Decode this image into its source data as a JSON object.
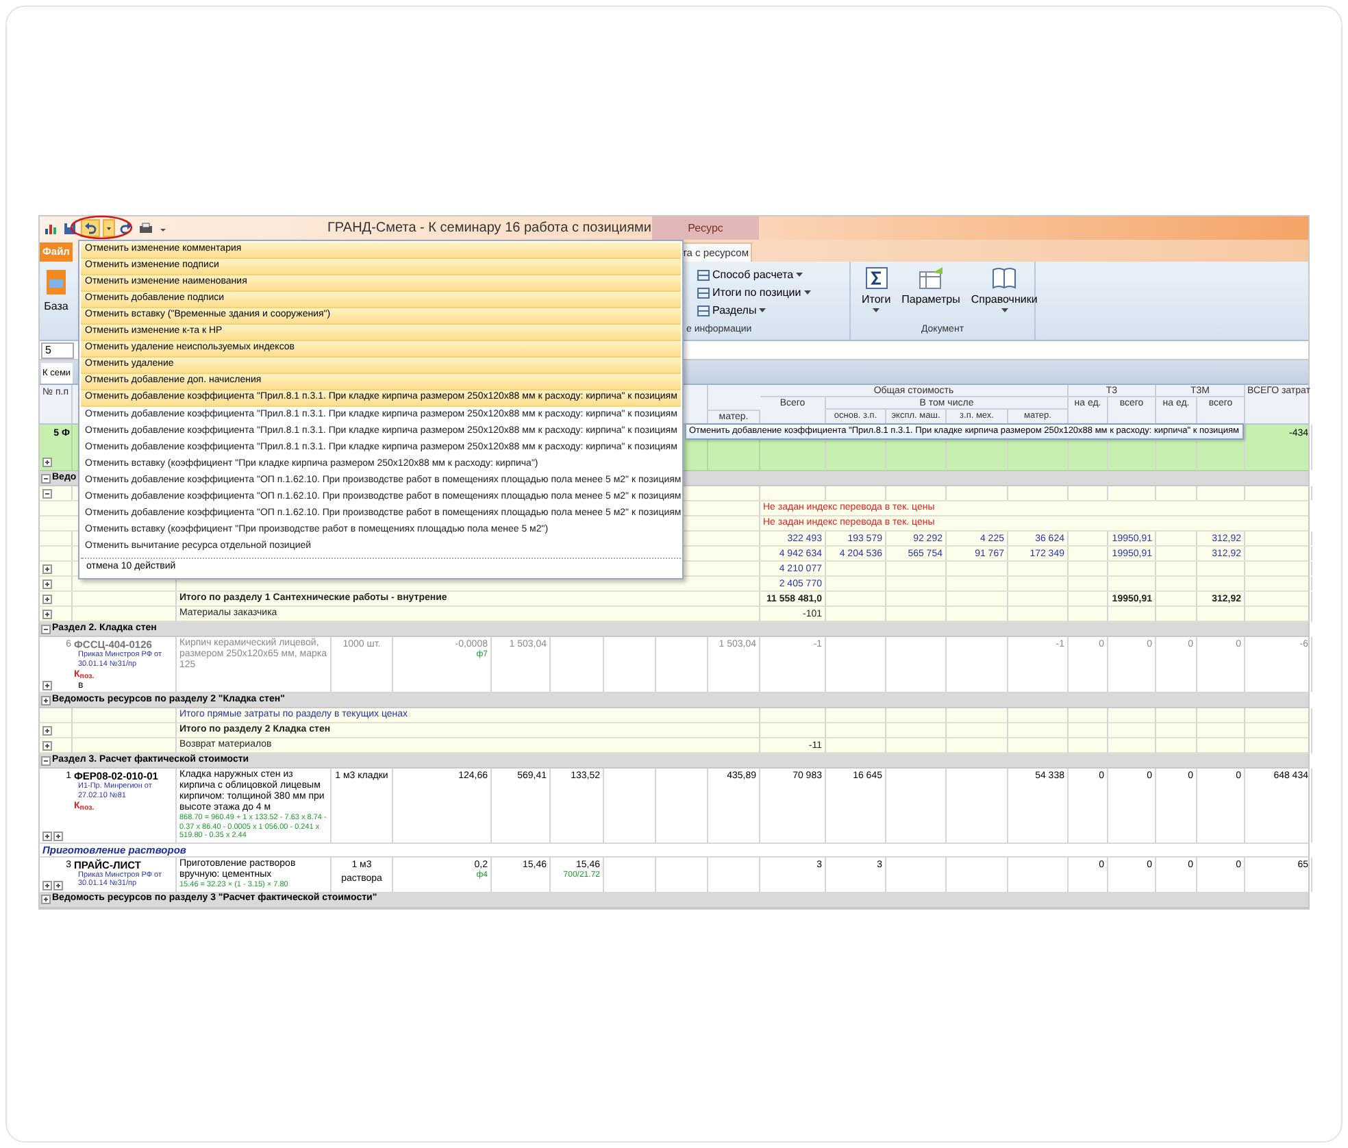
{
  "window": {
    "title": "ГРАНД-Смета - К семинару 16 работа с позициями",
    "context_tab": "Ресурс"
  },
  "quick_access": [
    {
      "kind": "app",
      "pressed": false
    },
    {
      "kind": "save",
      "pressed": false
    },
    {
      "kind": "undo",
      "pressed": true
    },
    {
      "kind": "caret",
      "pressed": true
    },
    {
      "kind": "redo",
      "pressed": false
    },
    {
      "kind": "print",
      "pressed": false
    },
    {
      "kind": "customize",
      "pressed": false
    }
  ],
  "tabs": [
    {
      "label": "Файл",
      "selected": true
    },
    {
      "label": "та с ресурсом",
      "selected": false
    }
  ],
  "ribbon": {
    "base_button": "База",
    "small_buttons": [
      {
        "label": "Способ расчета",
        "dropdown": true
      },
      {
        "label": "Итоги по позиции",
        "dropdown": true
      },
      {
        "label": "Разделы",
        "dropdown": true
      }
    ],
    "group_label": "е информации",
    "large_buttons": [
      {
        "kind": "sum",
        "label": "Итоги",
        "dropdown": true
      },
      {
        "kind": "params",
        "label": "Параметры",
        "dropdown": false
      },
      {
        "kind": "book",
        "label": "Справочники",
        "dropdown": true
      }
    ],
    "doc_group": "Документ"
  },
  "page_field": {
    "value": "5"
  },
  "doc_tab": {
    "label": "К семи"
  },
  "header": {
    "number": "№ п.п",
    "left_cols": [
      "матер."
    ],
    "total_group": "Общая стоимость",
    "total": "Всего",
    "incl": "В том числе",
    "incl_cols": [
      "основ. з.п.",
      "экспл. маш.",
      "з.п. мех.",
      "матер."
    ],
    "tz": "Т3",
    "tz_cols": [
      "на ед.",
      "всего"
    ],
    "tzm": "Т3М",
    "tzm_cols": [
      "на ед.",
      "всего"
    ],
    "grand": "ВСЕГО затрат"
  },
  "rows": [
    {
      "kind": "current",
      "number": "5",
      "code": "Ф",
      "expanded": false,
      "cells": {
        "grand_total": "-434"
      }
    },
    {
      "kind": "section",
      "title": "Ведо",
      "expanded": true
    },
    {
      "kind": "subtotal",
      "accent": false,
      "expanded": true,
      "cells": {}
    },
    {
      "kind": "note",
      "note": "Не задан индекс перевода в тек. цены"
    },
    {
      "kind": "note",
      "note": "Не задан индекс перевода в тек. цены"
    },
    {
      "kind": "subtotal",
      "accent": true,
      "cells": {
        "total": "322 493",
        "base_wage": "193 579",
        "machines": "92 292",
        "mech_wage": "4 225",
        "materials": "36 624",
        "tz_total": "19950,91",
        "tzm_total": "312,92"
      }
    },
    {
      "kind": "subtotal",
      "accent": true,
      "cells": {
        "total": "4 942 634",
        "base_wage": "4 204 536",
        "machines": "565 754",
        "mech_wage": "91 767",
        "materials": "172 349",
        "tz_total": "19950,91",
        "tzm_total": "312,92"
      }
    },
    {
      "kind": "subtotal",
      "accent": true,
      "expanded": false,
      "cells": {
        "total": "4 210 077"
      }
    },
    {
      "kind": "subtotal",
      "accent": true,
      "expanded": false,
      "cells": {
        "total": "2 405 770"
      }
    },
    {
      "kind": "total",
      "accent": false,
      "expanded": false,
      "label": "Итого по разделу 1 Сантехнические работы - внутрение",
      "cells": {
        "total": "11 558 481,0",
        "tz_total": "19950,91",
        "tzm_total": "312,92"
      }
    },
    {
      "kind": "subtotal",
      "accent": false,
      "expanded": false,
      "label": "Материалы заказчика",
      "cells": {
        "total": "-101"
      }
    },
    {
      "kind": "section",
      "title": "Раздел 2. Кладка стен",
      "expanded": true
    },
    {
      "kind": "position",
      "muted": true,
      "number": "6",
      "code": "ФССЦ-404-0126",
      "source": "Приказ Минстроя РФ от 30.01.14 №31/пр",
      "coef": "К$_{поз.}$",
      "extra": "в",
      "toggles": [
        {
          "expanded": false
        }
      ],
      "name": "Кирпич керамический лицевой, размером 250x120x65 мм, марка 125",
      "unit": "1000 шт.",
      "qty": {
        "text": "-0,0008",
        "note": "ф7"
      },
      "cells": {
        "column_6": "1 503,04",
        "column_10": "1 503,04",
        "total": "-1",
        "materials": "-1",
        "tz_unit": "0",
        "tz_total": "0",
        "tzm_unit": "0",
        "tzm_total": "0",
        "grand_total": "-6"
      }
    },
    {
      "kind": "section",
      "title": "Ведомость ресурсов по разделу 2 \"Кладка стен\"",
      "expanded": false
    },
    {
      "kind": "subtotal",
      "accent": true,
      "label": "Итого прямые затраты по разделу в текущих ценах",
      "cells": {}
    },
    {
      "kind": "total",
      "accent": false,
      "expanded": false,
      "label": "Итого по разделу 2 Кладка стен",
      "cells": {}
    },
    {
      "kind": "subtotal",
      "accent": false,
      "expanded": false,
      "label": "Возврат материалов",
      "cells": {
        "total": "-11"
      }
    },
    {
      "kind": "section",
      "title": "Раздел 3. Расчет фактической стоимости",
      "expanded": true
    },
    {
      "kind": "position",
      "muted": false,
      "number": "1",
      "code": "ФЕР08-02-010-01",
      "source": "И1-Пр. Минрегион от 27.02.10 №81",
      "coef": "К$_{поз.}$",
      "toggles": [
        {
          "expanded": false
        },
        {
          "expanded": false
        }
      ],
      "name": "Кладка наружных стен из кирпича с облицовкой лицевым кирпичом: толщиной 380 мм при высоте этажа до 4 м",
      "formula": "868.70 = 960.49 + 1 x 133.52 - 7.63 x 8.74 - 0.37 x 86.40 - 0.0005 x 1 056.00 - 0.241 x 519.80 - 0.35 x 2.44",
      "unit": "1 м3 кладки",
      "qty": {
        "text": "124,66"
      },
      "cells": {
        "column_6": "569,41",
        "column_7": "133,52",
        "column_10": "435,89",
        "total": "70 983",
        "base_wage": "16 645",
        "materials": "54 338",
        "tz_unit": "0",
        "tz_total": "0",
        "tzm_unit": "0",
        "tzm_total": "0",
        "grand_total": "648 434"
      }
    },
    {
      "kind": "category",
      "title": "Приготовление растворов"
    },
    {
      "kind": "position",
      "muted": false,
      "number": "3",
      "code": "ПРАЙС-ЛИСТ",
      "source": "Приказ Минстроя РФ от 30.01.14 №31/пр",
      "toggles": [
        {
          "expanded": false
        },
        {
          "expanded": false
        }
      ],
      "name": "Приготовление растворов вручную: цементных",
      "formula": "15.46 = 32.23 × (1 - 3.15) × 7.80",
      "unit": "1 м3 раствора",
      "qty": {
        "text": "0,2",
        "note": "ф4"
      },
      "cells": {
        "column_6": "15,46",
        "column_7": {
          "text": "15,46",
          "note": "700/21.72"
        },
        "total": "3",
        "base_wage": "3",
        "tz_unit": "0",
        "tz_total": "0",
        "tzm_unit": "0",
        "tzm_total": "0",
        "grand_total": "65"
      }
    },
    {
      "kind": "section",
      "title": "Ведомость ресурсов по разделу 3 \"Расчет фактической стоимости\"",
      "expanded": false
    }
  ],
  "undo_menu": {
    "items": [
      {
        "label": "Отменить изменение комментария",
        "selected": true
      },
      {
        "label": "Отменить изменение подписи",
        "selected": true
      },
      {
        "label": "Отменить изменение наименования",
        "selected": true
      },
      {
        "label": "Отменить добавление подписи",
        "selected": true
      },
      {
        "label": "Отменить вставку (\"Временные здания и сооружения\")",
        "selected": true
      },
      {
        "label": "Отменить изменение к-та к НР",
        "selected": true
      },
      {
        "label": "Отменить удаление неиспользуемых индексов",
        "selected": true
      },
      {
        "label": "Отменить удаление",
        "selected": true
      },
      {
        "label": "Отменить добавление доп. начисления",
        "selected": true
      },
      {
        "label": "Отменить добавление коэффициента \"Прил.8.1 п.3.1. При кладке кирпича размером 250x120x88 мм к расходу: кирпича\" к позициям",
        "selected": true
      },
      {
        "label": "Отменить добавление коэффициента \"Прил.8.1 п.3.1. При кладке кирпича размером 250x120x88 мм к расходу: кирпича\" к позициям",
        "selected": false
      },
      {
        "label": "Отменить добавление коэффициента \"Прил.8.1 п.3.1. При кладке кирпича размером 250x120x88 мм к расходу: кирпича\" к позициям",
        "selected": false
      },
      {
        "label": "Отменить добавление коэффициента \"Прил.8.1 п.3.1. При кладке кирпича размером 250x120x88 мм к расходу: кирпича\" к позициям",
        "selected": false
      },
      {
        "label": "Отменить вставку (коэффициент \"При кладке кирпича размером 250x120x88 мм к расходу: кирпича\")",
        "selected": false
      },
      {
        "label": "Отменить добавление коэффициента \"ОП п.1.62.10. При производстве работ в помещениях площадью пола менее 5 м2\" к позициям",
        "selected": false
      },
      {
        "label": "Отменить добавление коэффициента \"ОП п.1.62.10. При производстве работ в помещениях площадью пола менее 5 м2\" к позициям",
        "selected": false
      },
      {
        "label": "Отменить добавление коэффициента \"ОП п.1.62.10. При производстве работ в помещениях площадью пола менее 5 м2\" к позициям",
        "selected": false
      },
      {
        "label": "Отменить вставку (коэффициент \"При производстве работ в помещениях площадью пола менее 5 м2\")",
        "selected": false
      },
      {
        "label": "Отменить вычитание ресурса отдельной позицией",
        "selected": false
      }
    ],
    "footer": "отмена 10 действий"
  },
  "tooltip": {
    "text": "Отменить добавление коэффициента \"Прил.8.1 п.3.1. При кладке кирпича размером 250x120x88 мм к расходу: кирпича\" к позициям"
  }
}
